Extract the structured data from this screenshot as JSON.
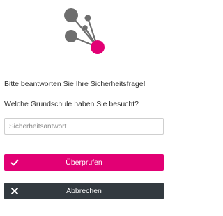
{
  "logo": {
    "icon": "network-nodes-icon",
    "colors": {
      "nodes": "#6e6e6e",
      "accent": "#e20074"
    }
  },
  "security_question": {
    "intro_text": "Bitte beantworten Sie Ihre Sicherheitsfrage!",
    "question_text": "Welche Grundschule haben Sie besucht?",
    "answer_field": {
      "value": "",
      "placeholder": "Sicherheitsantwort"
    }
  },
  "buttons": {
    "confirm": {
      "label": "Überprüfen",
      "icon": "checkmark-icon",
      "color": "#e20074"
    },
    "cancel": {
      "label": "Abbrechen",
      "icon": "close-icon",
      "color": "#333a40"
    }
  }
}
